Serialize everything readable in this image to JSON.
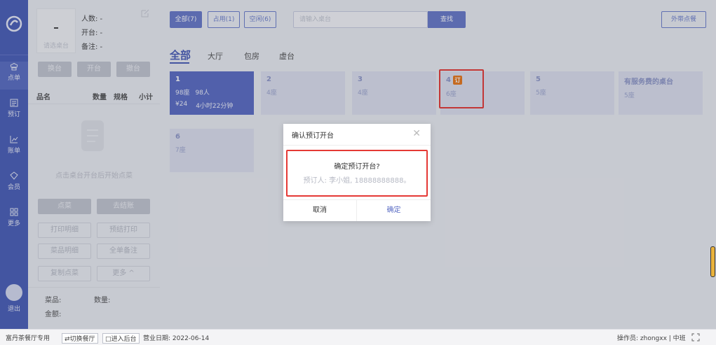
{
  "nav": {
    "items": [
      {
        "label": "点单",
        "icon": "chef-hat-icon"
      },
      {
        "label": "预订",
        "icon": "reservation-icon"
      },
      {
        "label": "账单",
        "icon": "chart-icon"
      },
      {
        "label": "会员",
        "icon": "member-icon"
      },
      {
        "label": "更多",
        "icon": "grid-icon"
      }
    ],
    "exit_label": "退出"
  },
  "panel": {
    "thumb_label": "请选桌台",
    "people": "人数: -",
    "opened": "开台: -",
    "note": "备注: -",
    "btn_change": "换台",
    "btn_open": "开台",
    "btn_merge": "撤台",
    "col_name": "品名",
    "col_qty": "数量",
    "col_spec": "规格",
    "col_sub": "小计",
    "empty_text": "点击桌台开台后开始点菜",
    "btn_order": "点菜",
    "btn_checkout": "去结账",
    "btn_print_detail": "打印明细",
    "btn_pre_print": "预结打印",
    "btn_dish_detail": "菜品明细",
    "btn_all_note": "全单备注",
    "btn_copy": "复制点菜",
    "btn_more": "更多 ^",
    "dish_label": "菜品:",
    "qty_label": "数量:",
    "amount_label": "金额:"
  },
  "main": {
    "filters": [
      "全部(7)",
      "占用(1)",
      "空闲(6)"
    ],
    "search_placeholder": "请输入桌台",
    "find_label": "查找",
    "takeout_label": "外带点餐",
    "areas": [
      "全部",
      "大厅",
      "包房",
      "虚台"
    ],
    "tables": [
      {
        "no": "1",
        "seats": "98座",
        "people": "98人",
        "amount": "¥24",
        "time": "4小时22分钟",
        "busy": true
      },
      {
        "no": "2",
        "seats": "4座"
      },
      {
        "no": "3",
        "seats": "4座"
      },
      {
        "no": "4",
        "seats": "6座",
        "badge": "订"
      },
      {
        "no": "5",
        "seats": "5座"
      },
      {
        "no": "有服务费的桌台",
        "seats": "5座"
      },
      {
        "no": "6",
        "seats": "7座"
      }
    ]
  },
  "dialog": {
    "title": "确认预订开台",
    "question": "确定预订开台?",
    "booker": "预订人: 李小姐, 18888888888。",
    "cancel": "取消",
    "confirm": "确定"
  },
  "status": {
    "shop": "富丹茶餐厅专用",
    "switch": "⇄切换餐厅",
    "backend": "□进入后台",
    "date": "营业日期: 2022-06-14",
    "operator": "操作员: zhongxx | 中班"
  },
  "colors": {
    "nav": "#4a5eb8",
    "accent": "#6879c9",
    "busy_card": "#5b6cc4",
    "badge": "#e8781c",
    "highlight": "#e53935"
  }
}
